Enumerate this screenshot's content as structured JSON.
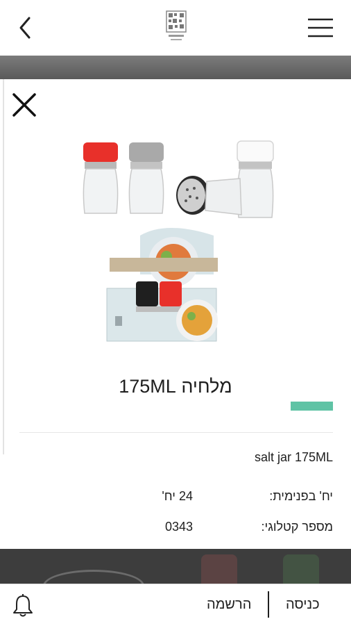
{
  "header": {
    "back_icon": "chevron-left-icon",
    "logo_icon": "brand-logo-icon",
    "menu_icon": "hamburger-menu-icon"
  },
  "modal": {
    "close_icon": "close-icon",
    "product_image": "salt-jar-product-photo",
    "title": "מלחיה 175ML",
    "accent_color": "#5fc3a5",
    "english_name": "salt jar 175ML",
    "details": [
      {
        "label": "יח' בפנימית:",
        "value": "24 יח'"
      },
      {
        "label": "מספר קטלוגי:",
        "value": "0343"
      }
    ]
  },
  "bottom_bar": {
    "bell_icon": "bell-icon",
    "register_label": "הרשמה",
    "login_label": "כניסה"
  }
}
